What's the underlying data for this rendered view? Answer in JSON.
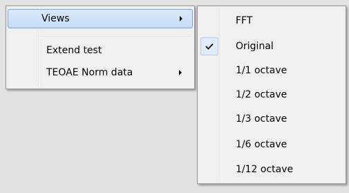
{
  "main_menu": {
    "items": [
      {
        "label": "Views",
        "has_submenu": true,
        "highlighted": true
      },
      {
        "label": "Extend test",
        "has_submenu": false
      },
      {
        "label": "TEOAE Norm data",
        "has_submenu": true
      }
    ]
  },
  "views_submenu": {
    "items": [
      {
        "label": "FFT",
        "checked": false
      },
      {
        "label": "Original",
        "checked": true
      },
      {
        "label": "1/1 octave",
        "checked": false
      },
      {
        "label": "1/2 octave",
        "checked": false
      },
      {
        "label": "1/3 octave",
        "checked": false
      },
      {
        "label": "1/6 octave",
        "checked": false
      },
      {
        "label": "1/12 octave",
        "checked": false
      }
    ]
  },
  "colors": {
    "menu_background": "#f0f0f0",
    "highlight_background": "#c6dcf5",
    "highlight_border": "#7da2ce",
    "grid_line": "#e2e2e2"
  },
  "icons": {
    "submenu_arrow": "chevron-right-icon",
    "checkmark": "checkmark-icon"
  }
}
